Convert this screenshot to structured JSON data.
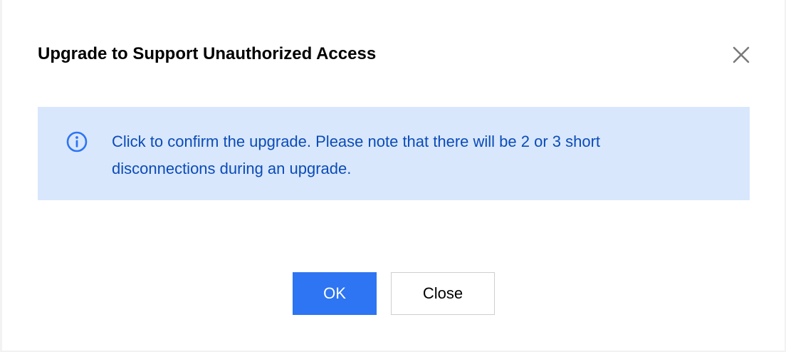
{
  "dialog": {
    "title": "Upgrade to Support Unauthorized Access",
    "close_icon": "close-icon",
    "alert": {
      "icon": "info-icon",
      "message": "Click to confirm the upgrade. Please note that there will be 2 or 3 short disconnections during an upgrade."
    },
    "buttons": {
      "ok_label": "OK",
      "close_label": "Close"
    }
  },
  "colors": {
    "primary": "#2d75f2",
    "alert_background": "#d9e7fd",
    "alert_text": "#0a4cb7"
  }
}
